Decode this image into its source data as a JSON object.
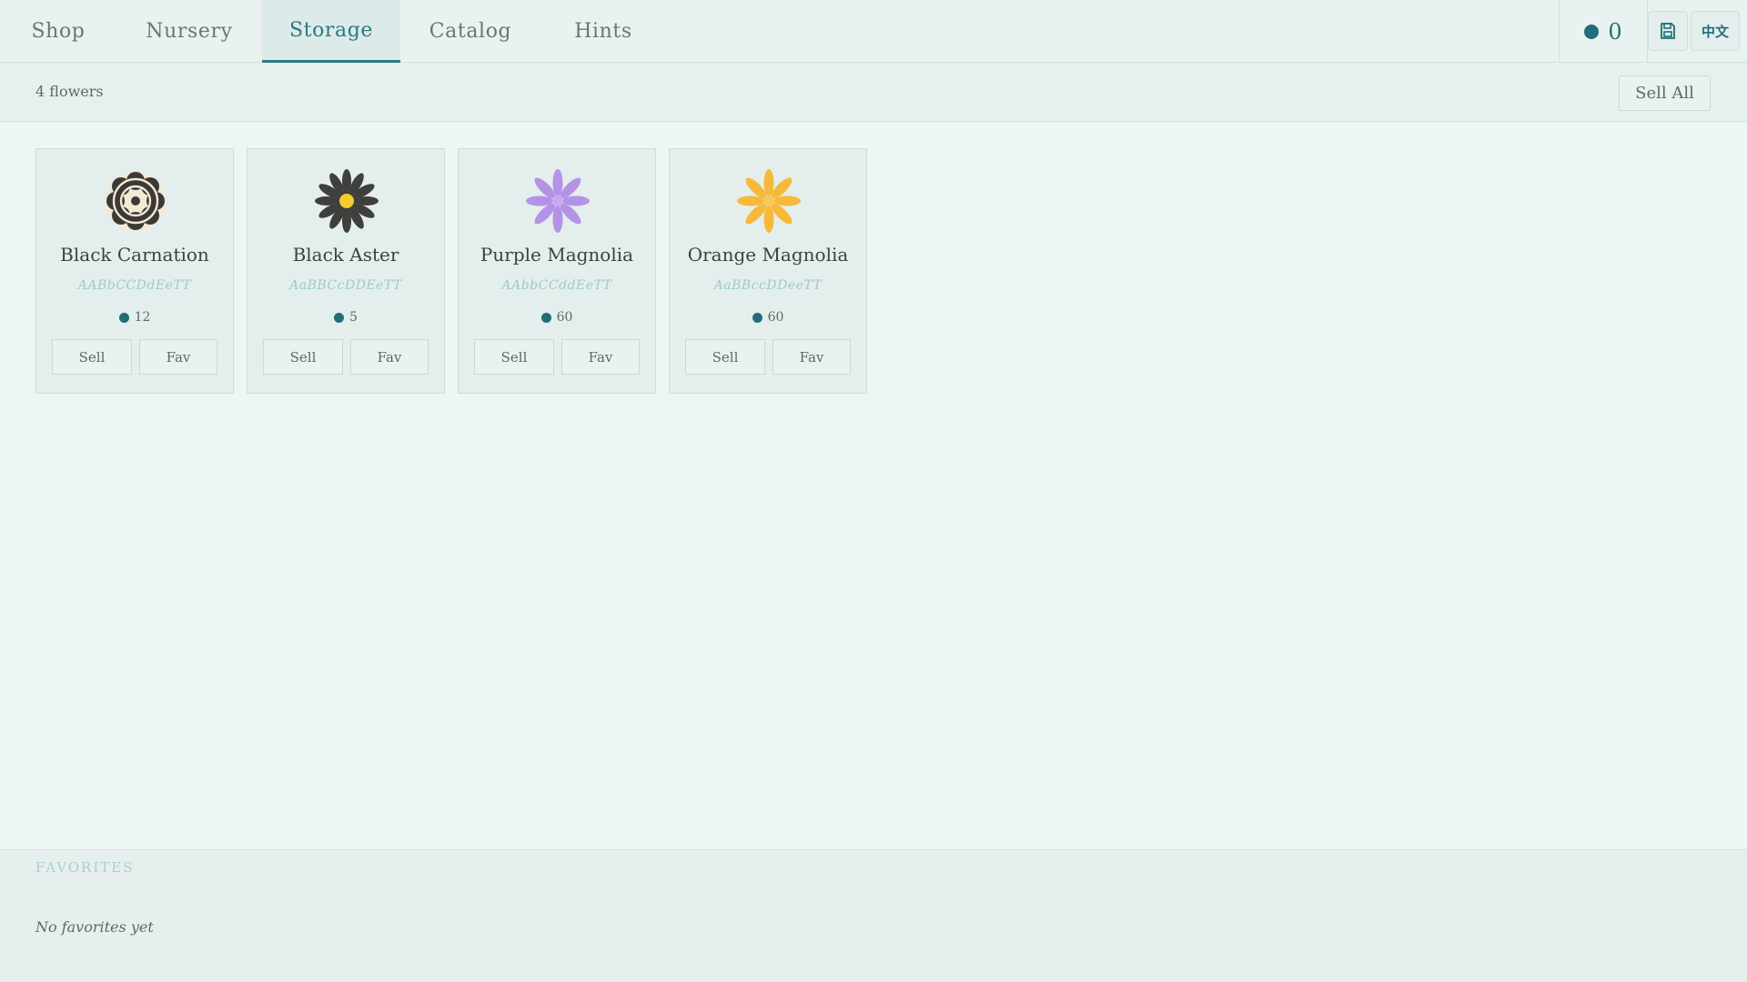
{
  "nav": {
    "tabs": [
      {
        "label": "Shop"
      },
      {
        "label": "Nursery"
      },
      {
        "label": "Storage",
        "active": true
      },
      {
        "label": "Catalog"
      },
      {
        "label": "Hints"
      }
    ],
    "coins": "0",
    "coin_icon": "coin-dot",
    "save_icon": "save-icon",
    "language_label": "中文"
  },
  "toolbar": {
    "count_text": "4 flowers",
    "sell_all_label": "Sell All"
  },
  "flowers": [
    {
      "name": "Black Carnation",
      "genes": "AABbCCDdEeTT",
      "price": "12",
      "sell_label": "Sell",
      "fav_label": "Fav",
      "icon": "black-carnation-icon",
      "color": "#3b3a37"
    },
    {
      "name": "Black Aster",
      "genes": "AaBBCcDDEeTT",
      "price": "5",
      "sell_label": "Sell",
      "fav_label": "Fav",
      "icon": "black-aster-icon",
      "color": "#3f3f3d"
    },
    {
      "name": "Purple Magnolia",
      "genes": "AAbbCCddEeTT",
      "price": "60",
      "sell_label": "Sell",
      "fav_label": "Fav",
      "icon": "purple-magnolia-icon",
      "color": "#b493e6"
    },
    {
      "name": "Orange Magnolia",
      "genes": "AaBBccDDeeTT",
      "price": "60",
      "sell_label": "Sell",
      "fav_label": "Fav",
      "icon": "orange-magnolia-icon",
      "color": "#f7b93a"
    }
  ],
  "favorites": {
    "title": "FAVORITES",
    "empty_text": "No favorites yet"
  },
  "colors": {
    "accent": "#2b7a80",
    "coin": "#1f6e79",
    "background": "#eef6f5"
  }
}
